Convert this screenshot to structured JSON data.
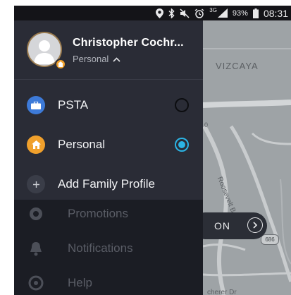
{
  "status_bar": {
    "network": "3G",
    "battery_percent": "93%",
    "time": "08:31"
  },
  "drawer": {
    "user_name": "Christopher Cochr...",
    "current_profile": "Personal",
    "profiles": [
      {
        "label": "PSTA",
        "icon": "briefcase-icon",
        "icon_color": "#3d7ad8",
        "selected": false
      },
      {
        "label": "Personal",
        "icon": "home-icon",
        "icon_color": "#f0a02c",
        "selected": true
      },
      {
        "label": "Add Family Profile",
        "icon": "plus-icon",
        "icon_color": "#3a3d48",
        "selected": false
      }
    ],
    "accent_color": "#2bb4e4"
  },
  "background_menu": {
    "items": [
      {
        "label": "Promotions",
        "icon": "promotions-icon"
      },
      {
        "label": "Notifications",
        "icon": "bell-icon"
      },
      {
        "label": "Help",
        "icon": "help-icon"
      }
    ]
  },
  "map": {
    "area_label": "VIZCAYA",
    "road_label": "Roosevelt B",
    "street_label": "cherer Dr",
    "route_shield": "686",
    "corner_number": "0"
  },
  "go_button": {
    "label": "ON"
  }
}
